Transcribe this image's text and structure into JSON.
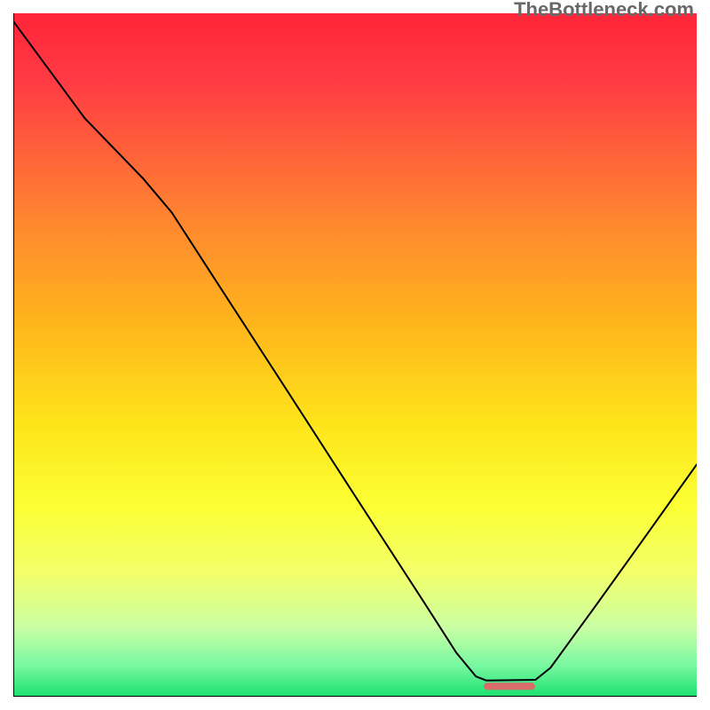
{
  "watermark": "TheBottleneck.com",
  "marker": {
    "x_center_frac": 0.726,
    "y_from_bottom_frac": 0.01,
    "width_frac": 0.075,
    "height_frac": 0.01,
    "fill": "#d96b6b",
    "rx": 4
  },
  "gradient": {
    "stops": [
      {
        "offset": 0.0,
        "color": "#ff2439"
      },
      {
        "offset": 0.1,
        "color": "#ff3b44"
      },
      {
        "offset": 0.3,
        "color": "#ff8530"
      },
      {
        "offset": 0.45,
        "color": "#ffb41c"
      },
      {
        "offset": 0.6,
        "color": "#fee41a"
      },
      {
        "offset": 0.72,
        "color": "#fbff33"
      },
      {
        "offset": 0.82,
        "color": "#f2ff6b"
      },
      {
        "offset": 0.9,
        "color": "#c9ffa4"
      },
      {
        "offset": 0.955,
        "color": "#77f8a1"
      },
      {
        "offset": 1.0,
        "color": "#1be070"
      }
    ]
  },
  "axes": {
    "stroke": "#000000",
    "width": 2
  },
  "chart_data": {
    "type": "line",
    "note": "Axes are unlabeled. x and y are given in plot-area fractions: x in [0,1] left→right; y in [0,1] where 1 is the top of the curve and 0 is the baseline (minimum distance to the green zone / marker level).",
    "series": [
      {
        "name": "bottleneck-curve",
        "points": [
          {
            "x": 0.0,
            "y": 1.0
          },
          {
            "x": 0.105,
            "y": 0.854
          },
          {
            "x": 0.19,
            "y": 0.764
          },
          {
            "x": 0.232,
            "y": 0.713
          },
          {
            "x": 0.3,
            "y": 0.605
          },
          {
            "x": 0.4,
            "y": 0.447
          },
          {
            "x": 0.5,
            "y": 0.288
          },
          {
            "x": 0.6,
            "y": 0.13
          },
          {
            "x": 0.648,
            "y": 0.053
          },
          {
            "x": 0.677,
            "y": 0.017
          },
          {
            "x": 0.692,
            "y": 0.011
          },
          {
            "x": 0.764,
            "y": 0.012
          },
          {
            "x": 0.786,
            "y": 0.03
          },
          {
            "x": 0.85,
            "y": 0.12
          },
          {
            "x": 0.92,
            "y": 0.22
          },
          {
            "x": 1.0,
            "y": 0.335
          }
        ]
      }
    ],
    "marker_x_range": [
      0.688,
      0.763
    ]
  }
}
